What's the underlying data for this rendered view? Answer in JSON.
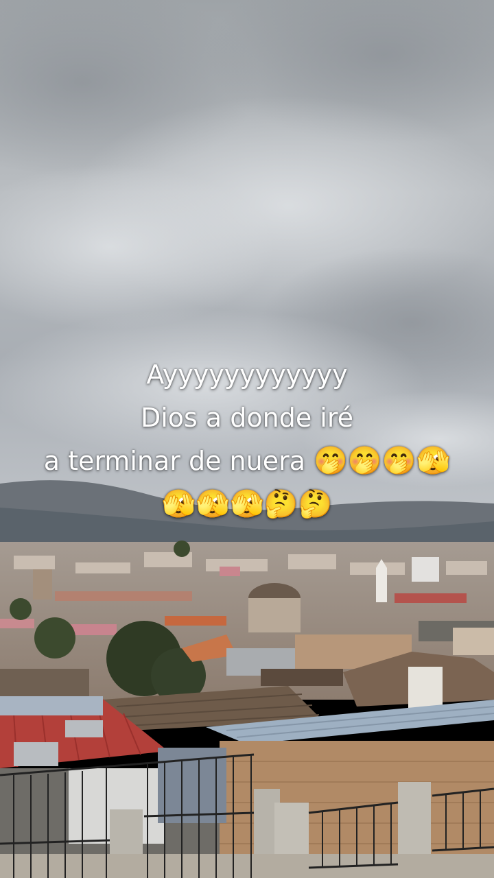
{
  "caption": {
    "line1": "Ayyyyyyyyyyyy",
    "line2": "Dios a donde iré",
    "line3_text": "a terminar de nuera",
    "line3_emojis": "🤭🤭🤭🫣",
    "line4_emojis": "🫣🫣🫣🤔🤔"
  }
}
